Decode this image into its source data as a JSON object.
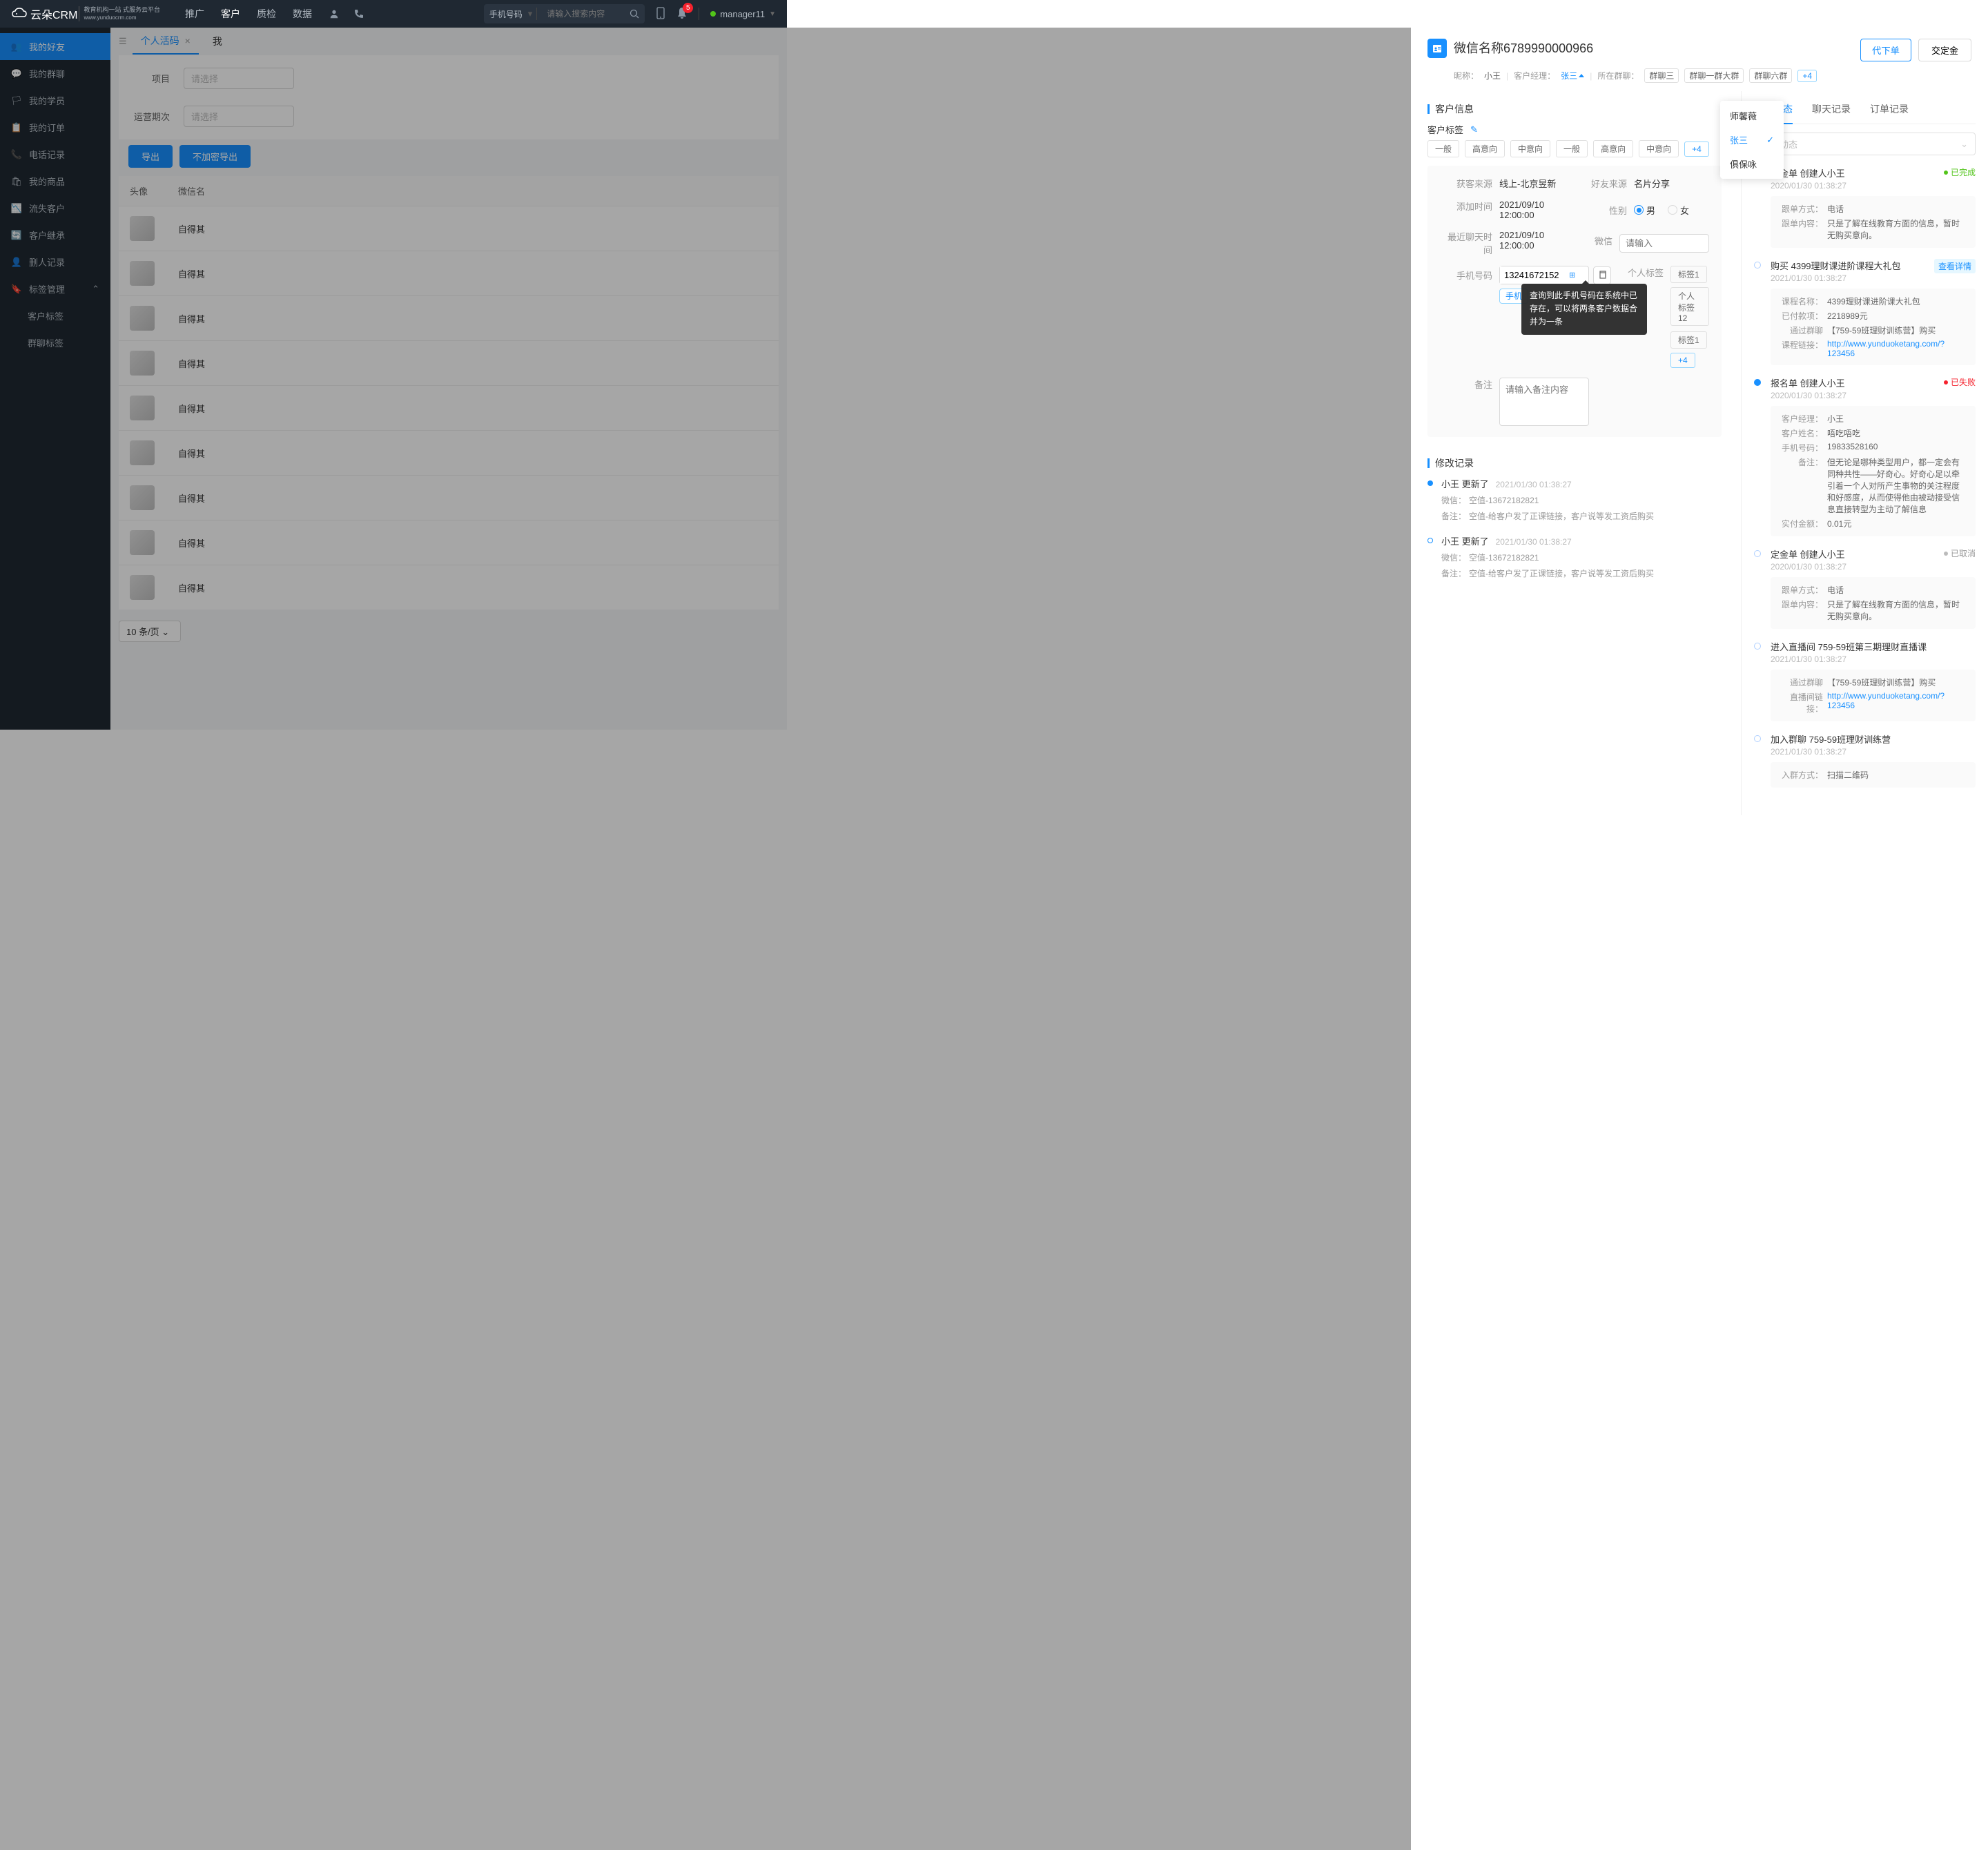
{
  "topbar": {
    "logo": "云朵CRM",
    "logoSub": "教育机构一站\n式服务云平台",
    "logoUrl": "www.yunduocrm.com",
    "nav": [
      "推广",
      "客户",
      "质检",
      "数据"
    ],
    "navActive": 1,
    "searchType": "手机号码",
    "searchPlaceholder": "请输入搜索内容",
    "notifCount": "5",
    "user": "manager11"
  },
  "sidebar": {
    "items": [
      {
        "label": "我的好友",
        "active": true
      },
      {
        "label": "我的群聊"
      },
      {
        "label": "我的学员"
      },
      {
        "label": "我的订单"
      },
      {
        "label": "电话记录"
      },
      {
        "label": "我的商品"
      },
      {
        "label": "流失客户"
      },
      {
        "label": "客户继承"
      },
      {
        "label": "删人记录"
      },
      {
        "label": "标签管理",
        "expand": true
      }
    ],
    "sub": [
      "客户标签",
      "群聊标签"
    ]
  },
  "mainBg": {
    "tabs": [
      {
        "label": "个人活码",
        "active": true,
        "closable": true
      },
      {
        "label": "我"
      }
    ],
    "filters": [
      {
        "label": "项目",
        "placeholder": "请选择"
      },
      {
        "label": "运营期次",
        "placeholder": "请选择"
      }
    ],
    "actions": {
      "export": "导出",
      "export2": "不加密导出"
    },
    "cols": {
      "avatar": "头像",
      "name": "微信名"
    },
    "rowName": "自得其",
    "rowCount": 9,
    "pageSize": "10 条/页"
  },
  "drawer": {
    "title": "微信名称6789990000966",
    "actions": {
      "order": "代下单",
      "deposit": "交定金"
    },
    "meta": {
      "nickLabel": "昵称：",
      "nick": "小王",
      "mgrLabel": "客户经理：",
      "mgr": "张三",
      "groupLabel": "所在群聊：",
      "groups": [
        "群聊三",
        "群聊一群大群",
        "群聊六群"
      ],
      "groupPlus": "+4"
    },
    "mgrOptions": [
      "师馨薇",
      "张三",
      "俱保咏"
    ],
    "mgrSelected": 1,
    "secInfo": "客户信息",
    "tagsLabel": "客户标签",
    "tags": [
      "一般",
      "高意向",
      "中意向",
      "一般",
      "高意向",
      "中意向"
    ],
    "tagsPlus": "+4",
    "info": {
      "sourceLabel": "获客来源",
      "source": "线上-北京昱新",
      "friendSrcLabel": "好友来源",
      "friendSrc": "名片分享",
      "addTimeLabel": "添加时间",
      "addTime": "2021/09/10 12:00:00",
      "genderLabel": "性别",
      "male": "男",
      "female": "女",
      "lastChatLabel": "最近聊天时间",
      "lastChat": "2021/09/10 12:00:00",
      "wechatLabel": "微信",
      "wechatPlaceholder": "请输入",
      "phoneLabel": "手机号码",
      "phone": "13241672152",
      "phoneAdd": "手机",
      "phoneTooltip": "查询到此手机号码在系统中已存在，可以将两条客户数据合并为一条",
      "pTagLabel": "个人标签",
      "pTags": [
        "标签1",
        "个人标签12",
        "标签1"
      ],
      "pTagPlus": "+4",
      "remarkLabel": "备注",
      "remarkPlaceholder": "请输入备注内容"
    },
    "secHist": "修改记录",
    "hist": [
      {
        "who": "小王",
        "act": "更新了",
        "time": "2021/01/30  01:38:27",
        "details": [
          [
            "微信：",
            "空值-13672182821"
          ],
          [
            "备注：",
            "空值-给客户发了正课链接，客户说等发工资后购买"
          ]
        ],
        "solid": true
      },
      {
        "who": "小王",
        "act": "更新了",
        "time": "2021/01/30  01:38:27",
        "details": [
          [
            "微信：",
            "空值-13672182821"
          ],
          [
            "备注：",
            "空值-给客户发了正课链接，客户说等发工资后购买"
          ]
        ],
        "solid": false
      }
    ]
  },
  "right": {
    "tabs": [
      "客户动态",
      "聊天记录",
      "订单记录"
    ],
    "activeTab": 0,
    "filter": "全部动态",
    "timeline": [
      {
        "solid": true,
        "title": "定金单  创建人小王",
        "status": "已完成",
        "statusClass": "st-green",
        "time": "2020/01/30  01:38:27",
        "card": [
          [
            "跟单方式：",
            "电话"
          ],
          [
            "跟单内容：",
            "只是了解在线教育方面的信息，暂时无购买意向。"
          ]
        ]
      },
      {
        "solid": false,
        "title": "购买  4399理财课进阶课程大礼包",
        "detailBtn": "查看详情",
        "time": "2021/01/30  01:38:27",
        "card": [
          [
            "课程名称：",
            "4399理财课进阶课大礼包"
          ],
          [
            "已付款项：",
            "2218989元"
          ],
          [
            "通过群聊",
            "【759-59班理财训练营】购买"
          ],
          [
            "课程链接：",
            "http://www.yunduoketang.com/?123456",
            true
          ]
        ]
      },
      {
        "solid": true,
        "title": "报名单  创建人小王",
        "status": "已失败",
        "statusClass": "st-red",
        "time": "2020/01/30  01:38:27",
        "card": [
          [
            "客户经理：",
            "小王"
          ],
          [
            "客户姓名：",
            "唔吃唔吃"
          ],
          [
            "手机号码：",
            "19833528160"
          ],
          [
            "备注：",
            "但无论是哪种类型用户，都一定会有同种共性——好奇心。好奇心足以牵引着一个人对所产生事物的关注程度和好感度，从而使得他由被动接受信息直接转型为主动了解信息"
          ],
          [
            "实付金额：",
            "0.01元"
          ]
        ]
      },
      {
        "solid": false,
        "title": "定金单  创建人小王",
        "status": "已取消",
        "statusClass": "st-gray",
        "time": "2020/01/30  01:38:27",
        "card": [
          [
            "跟单方式：",
            "电话"
          ],
          [
            "跟单内容：",
            "只是了解在线教育方面的信息，暂时无购买意向。"
          ]
        ]
      },
      {
        "solid": false,
        "title": "进入直播间  759-59班第三期理财直播课",
        "time": "2021/01/30  01:38:27",
        "card": [
          [
            "通过群聊",
            "【759-59班理财训练营】购买"
          ],
          [
            "直播间链接：",
            "http://www.yunduoketang.com/?123456",
            true
          ]
        ]
      },
      {
        "solid": false,
        "title": "加入群聊  759-59班理财训练营",
        "time": "2021/01/30  01:38:27",
        "card": [
          [
            "入群方式：",
            "扫描二维码"
          ]
        ]
      }
    ]
  }
}
